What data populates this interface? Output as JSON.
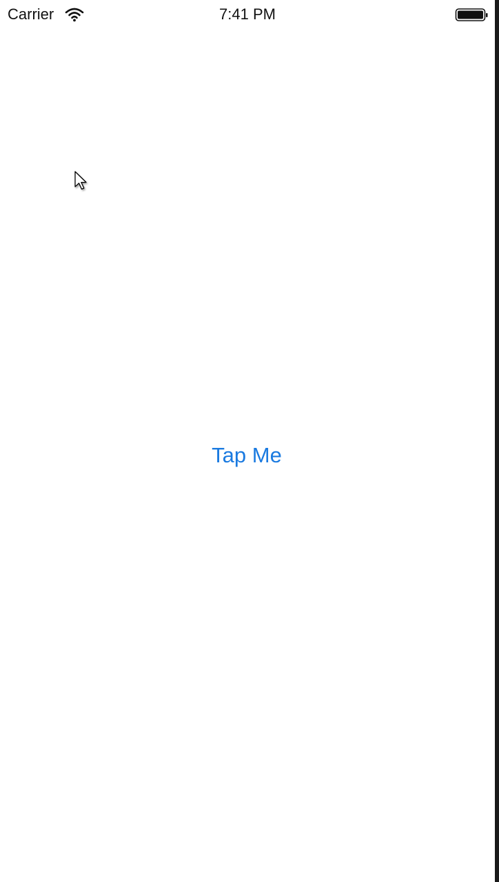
{
  "status_bar": {
    "carrier": "Carrier",
    "time": "7:41 PM",
    "wifi_icon": "wifi-icon",
    "battery_icon": "battery-icon"
  },
  "main": {
    "button_label": "Tap Me"
  },
  "pointer": {
    "icon": "cursor-icon"
  },
  "colors": {
    "background": "#ffffff",
    "status_text": "#111111",
    "button_tint": "#1a7ae0"
  }
}
